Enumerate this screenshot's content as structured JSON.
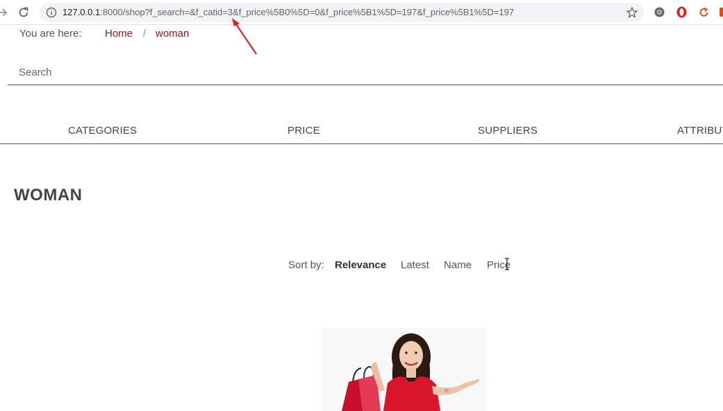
{
  "browser": {
    "url_host": "127.0.0.1",
    "url_rest": ":8000/shop?f_search=&f_catid=3&f_price%5B0%5D=0&f_price%5B1%5D=197&f_price%5B1%5D=197",
    "icons": [
      "forward-icon",
      "reload-icon",
      "info-icon",
      "bookmark-star-icon",
      "extension-icon",
      "opera-icon",
      "refresh-extension-icon"
    ]
  },
  "breadcrumb": {
    "prefix": "You are here:",
    "home": "Home",
    "separator": "/",
    "current": "woman"
  },
  "search": {
    "placeholder": "Search",
    "value": ""
  },
  "filters": {
    "tabs": [
      {
        "label": "CATEGORIES"
      },
      {
        "label": "PRICE"
      },
      {
        "label": "SUPPLIERS"
      },
      {
        "label": "ATTRIBUT"
      }
    ]
  },
  "page": {
    "title": "WOMAN"
  },
  "sort": {
    "label": "Sort by:",
    "options": [
      {
        "label": "Relevance",
        "active": true
      },
      {
        "label": "Latest",
        "active": false
      },
      {
        "label": "Name",
        "active": false
      },
      {
        "label": "Price",
        "active": false
      }
    ]
  },
  "colors": {
    "link": "#8b1a1a",
    "annotation": "#e02020",
    "omnibox_bg": "#f1f3f4",
    "dress": "#d8152b"
  }
}
